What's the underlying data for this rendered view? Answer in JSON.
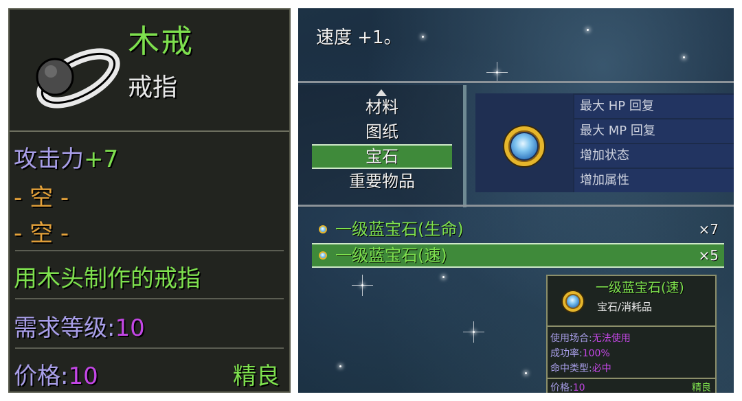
{
  "left_panel": {
    "item_name": "木戒",
    "item_type": "戒指",
    "icon": "ring-icon",
    "attack_label": "攻击力",
    "attack_value": "+7",
    "slot1": "- 空 -",
    "slot2": "- 空 -",
    "description": "用木头制作的戒指",
    "level_label": "需求等级:",
    "level_value": "10",
    "price_label": "价格:",
    "price_value": "10",
    "quality": "精良"
  },
  "right_panel": {
    "message": "速度 +1。",
    "categories": [
      "材料",
      "图纸",
      "宝石",
      "重要物品"
    ],
    "selected_category": "宝石",
    "detail_icon": "sapphire-gem-icon",
    "detail_stats": [
      "最大 HP 回复",
      "最大 MP 回复",
      "增加状态",
      "增加属性"
    ],
    "items": [
      {
        "name": "一级蓝宝石(生命)",
        "count": "×7",
        "selected": false
      },
      {
        "name": "一级蓝宝石(速)",
        "count": "×5",
        "selected": true
      }
    ],
    "tooltip": {
      "name": "一级蓝宝石(速)",
      "type": "宝石/消耗品",
      "usage_label": "使用场合:",
      "usage_value": "无法使用",
      "success_label": "成功率:",
      "success_value": "100%",
      "hit_label": "命中类型:",
      "hit_value": "必中",
      "price_label": "价格:",
      "price_value": "10",
      "quality": "精良"
    }
  },
  "colors": {
    "name_green": "#7ee04e",
    "label_purple": "#a89ee8",
    "value_magenta": "#c447e6",
    "slot_orange": "#e5a23a",
    "selection_green": "#3f8a3a"
  }
}
